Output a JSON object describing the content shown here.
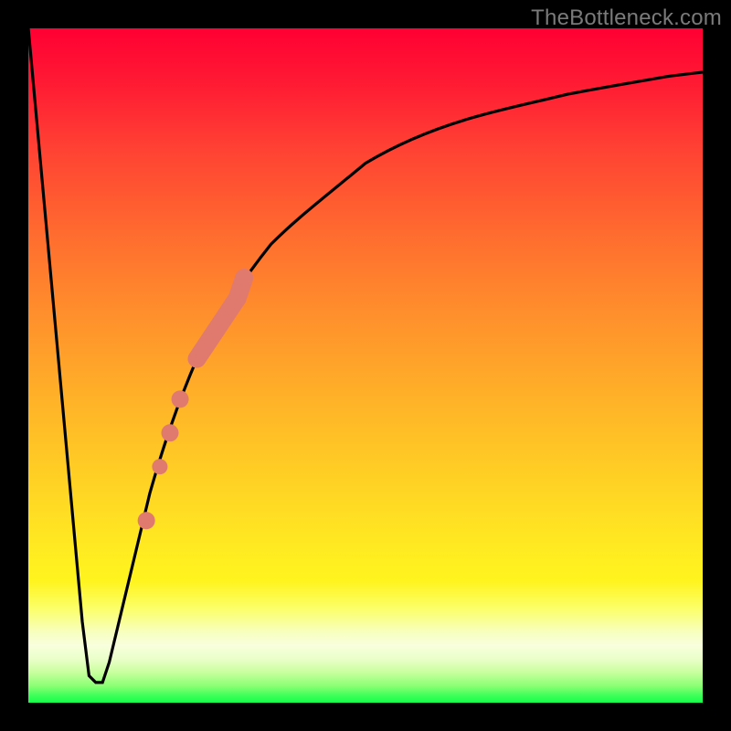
{
  "watermark": "TheBottleneck.com",
  "colors": {
    "frame": "#000000",
    "curve": "#000000",
    "marker_fill": "#e07a6e",
    "marker_stroke": "#e07a6e"
  },
  "chart_data": {
    "type": "line",
    "title": "",
    "xlabel": "",
    "ylabel": "",
    "xlim": [
      0,
      100
    ],
    "ylim": [
      0,
      100
    ],
    "grid": false,
    "legend": false,
    "background_gradient": {
      "direction": "vertical",
      "stops": [
        {
          "pos": 0.0,
          "color": "#ff0033"
        },
        {
          "pos": 0.5,
          "color": "#ffb228"
        },
        {
          "pos": 0.82,
          "color": "#fff41e"
        },
        {
          "pos": 0.92,
          "color": "#f7ffbe"
        },
        {
          "pos": 1.0,
          "color": "#17ff4a"
        }
      ]
    },
    "series": [
      {
        "name": "bottleneck-curve",
        "x": [
          0,
          2,
          4,
          6,
          8,
          9,
          10,
          11,
          12,
          14,
          16,
          18,
          20,
          22,
          25,
          28,
          32,
          36,
          40,
          45,
          50,
          55,
          60,
          65,
          70,
          75,
          80,
          85,
          90,
          95,
          100
        ],
        "y": [
          100,
          78,
          56,
          34,
          12,
          4,
          3,
          3,
          6,
          14,
          23,
          31,
          38,
          44,
          51,
          57,
          63,
          68,
          72,
          76,
          80,
          83,
          85.5,
          87.5,
          89,
          90.2,
          91.2,
          92,
          92.6,
          93.1,
          93.5
        ]
      }
    ],
    "markers": [
      {
        "name": "highlight-segment",
        "shape": "thick-line",
        "x_range": [
          25,
          32
        ],
        "y_range": [
          51,
          63
        ]
      },
      {
        "name": "dot-1",
        "shape": "circle",
        "x": 22.5,
        "y": 45
      },
      {
        "name": "dot-2",
        "shape": "circle",
        "x": 21.0,
        "y": 40
      },
      {
        "name": "dot-3",
        "shape": "circle",
        "x": 19.5,
        "y": 35
      },
      {
        "name": "dot-4",
        "shape": "circle",
        "x": 17.5,
        "y": 27
      }
    ]
  }
}
